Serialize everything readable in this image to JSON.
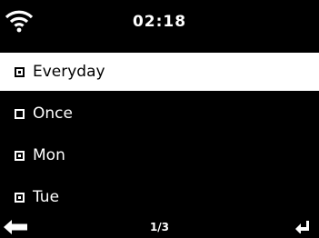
{
  "status_bar": {
    "time": "02:18",
    "wifi_icon": "wifi-icon"
  },
  "menu": {
    "items": [
      {
        "label": "Everyday",
        "checked": true,
        "selected": true
      },
      {
        "label": "Once",
        "checked": false,
        "selected": false
      },
      {
        "label": "Mon",
        "checked": true,
        "selected": false
      },
      {
        "label": "Tue",
        "checked": true,
        "selected": false
      }
    ]
  },
  "footer": {
    "page": "1/3",
    "back_icon": "arrow-left-icon",
    "enter_icon": "enter-icon"
  },
  "colors": {
    "background": "#000000",
    "foreground": "#ffffff",
    "highlight": "#ffffff",
    "highlight_text": "#000000"
  }
}
